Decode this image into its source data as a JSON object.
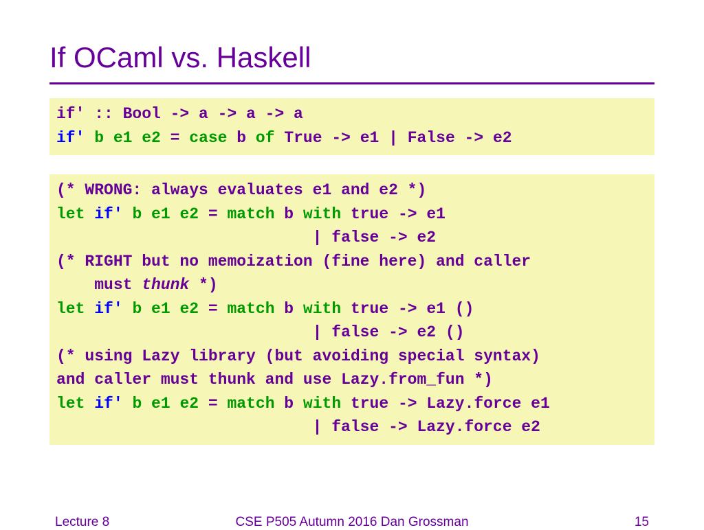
{
  "title": "If OCaml vs. Haskell",
  "block1": {
    "sig": "if' :: Bool -> a -> a -> a",
    "l2a": "if'",
    "l2b": " b e1 e2",
    "l2c": " = ",
    "l2d": "case",
    "l2e": " b ",
    "l2f": "of",
    "l2g": " True -> e1 | False -> e2"
  },
  "block2": {
    "c1": "(* WRONG: always evaluates e1 and e2 *)",
    "la1": "let",
    "la2": " if'",
    "la3": " b e1 e2",
    "la4": " = ",
    "la5": "match",
    "la6": " b ",
    "la7": "with",
    "la8": " true -> e1",
    "la9": "                           | false -> e2",
    "c2a": "(* RIGHT but no memoization (fine here) and caller",
    "c2b": "    must ",
    "c2thunk": "thunk",
    "c2c": " *)",
    "lb1": "let",
    "lb2": " if'",
    "lb3": " b e1 e2",
    "lb4": " = ",
    "lb5": "match",
    "lb6": " b ",
    "lb7": "with",
    "lb8": " true -> e1 ()",
    "lb9": "                           | false -> e2 ()",
    "c3a": "(* using Lazy library (but avoiding special syntax)",
    "c3b": "and caller must thunk and use Lazy.from_fun *)",
    "lc1": "let",
    "lc2": " if'",
    "lc3": " b e1 e2",
    "lc4": " = ",
    "lc5": "match",
    "lc6": " b ",
    "lc7": "with",
    "lc8": " true -> Lazy.force e1",
    "lc9": "                           | false -> Lazy.force e2"
  },
  "footer": {
    "left": "Lecture 8",
    "center": "CSE P505 Autumn 2016  Dan Grossman",
    "right": "15"
  }
}
